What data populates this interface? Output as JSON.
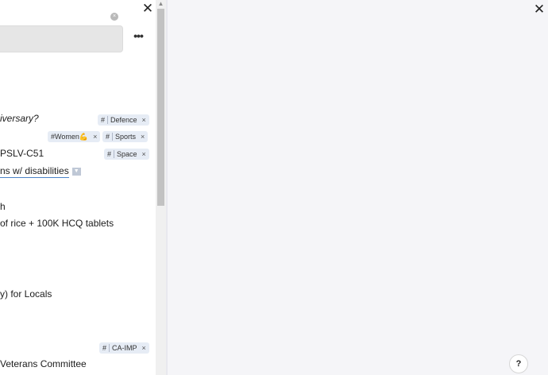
{
  "left_panel": {
    "rows": [
      {
        "text": "iversary?",
        "italic": true
      },
      {
        "text": "PSLV-C51"
      },
      {
        "text": "ns w/ disabilities",
        "link": true
      },
      {
        "text": "h"
      },
      {
        "text": "of rice + 100K HCQ tablets"
      },
      {
        "text": "y) for Locals"
      },
      {
        "text": "Veterans Committee"
      }
    ],
    "tags": [
      {
        "hash": "#",
        "label": "Defence",
        "x": "×"
      },
      {
        "hash": "",
        "label": "#Women💪",
        "x": "×"
      },
      {
        "hash": "#",
        "label": "Sports",
        "x": "×"
      },
      {
        "hash": "#",
        "label": "Space",
        "x": "×"
      },
      {
        "hash": "#",
        "label": "CA-IMP",
        "x": "×"
      }
    ],
    "close_glyph": "✕",
    "more_glyph": "•••",
    "clear_glyph": "×"
  },
  "right_panel": {
    "close_glyph": "✕",
    "help_label": "?"
  },
  "icons": {
    "left_close": "close-icon",
    "right_close": "close-icon",
    "more": "more-horizontal-icon",
    "help": "help-icon",
    "dropdown": "chevron-down-icon"
  },
  "colors": {
    "tag_bg": "#e6ecf5",
    "link_underline": "#4b83c7",
    "panel_bg": "#f5f5f8"
  }
}
